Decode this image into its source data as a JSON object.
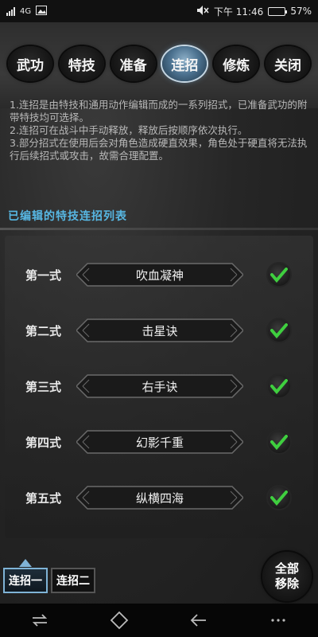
{
  "status_bar": {
    "network": "4G",
    "time": "下午 11:46",
    "battery": "57%",
    "battery_level": 0.57
  },
  "tabs": [
    {
      "label": "武功",
      "active": false
    },
    {
      "label": "特技",
      "active": false
    },
    {
      "label": "准备",
      "active": false
    },
    {
      "label": "连招",
      "active": true
    },
    {
      "label": "修炼",
      "active": false
    },
    {
      "label": "关闭",
      "active": false
    }
  ],
  "description": [
    "1.连招是由特技和通用动作编辑而成的一系列招式，已准备武功的附带特技均可选择。",
    "2.连招可在战斗中手动释放，释放后按顺序依次执行。",
    "3.部分招式在使用后会对角色造成硬直效果，角色处于硬直将无法执行后续招式或攻击，故需合理配置。"
  ],
  "section_title": "已编辑的特技连招列表",
  "combos": [
    {
      "label": "第一式",
      "name": "吹血凝神",
      "checked": true
    },
    {
      "label": "第二式",
      "name": "击星诀",
      "checked": true
    },
    {
      "label": "第三式",
      "name": "右手诀",
      "checked": true
    },
    {
      "label": "第四式",
      "name": "幻影千重",
      "checked": true
    },
    {
      "label": "第五式",
      "name": "纵横四海",
      "checked": true
    }
  ],
  "bottom_tabs": [
    {
      "label": "连招一",
      "active": true
    },
    {
      "label": "连招二",
      "active": false
    }
  ],
  "remove_all": {
    "line1": "全部",
    "line2": "移除"
  },
  "colors": {
    "accent_blue": "#57b7e3",
    "check_green": "#3fcf3f",
    "active_tab": "#4d7391"
  },
  "icons": [
    "signal-icon",
    "image-icon",
    "mute-icon",
    "battery-icon",
    "check-icon",
    "recent-apps-icon",
    "home-icon",
    "back-icon",
    "menu-icon"
  ]
}
